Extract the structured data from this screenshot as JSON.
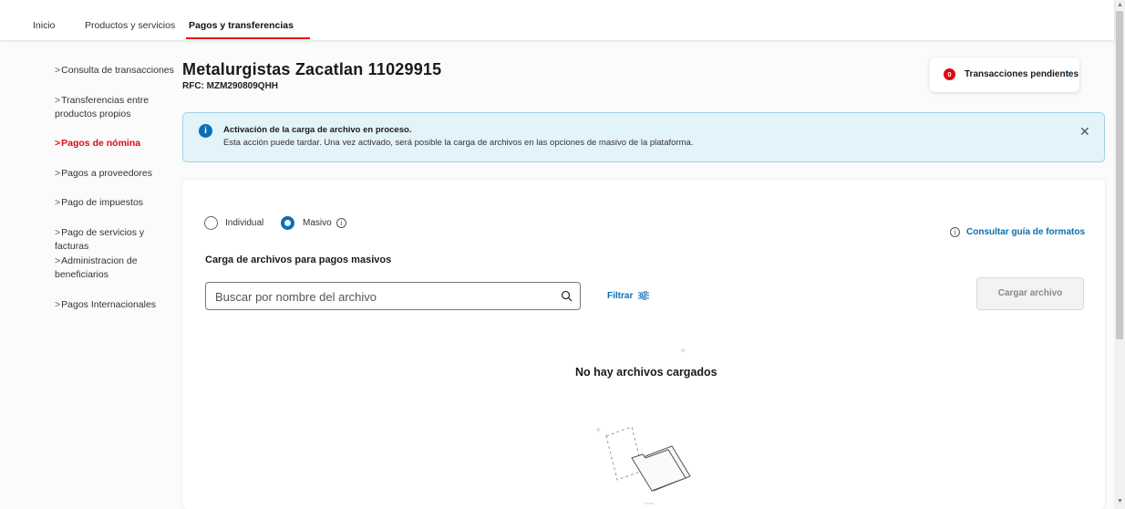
{
  "topnav": {
    "tabs": [
      {
        "label": "Inicio"
      },
      {
        "label": "Productos y servicios"
      },
      {
        "label": "Pagos y transferencias",
        "active": true
      }
    ]
  },
  "sidebar": {
    "items": [
      {
        "label": "Consulta de transacciones"
      },
      {
        "label": "Transferencias entre productos propios"
      },
      {
        "label": "Pagos de nómina",
        "active": true
      },
      {
        "label": "Pagos a proveedores"
      },
      {
        "label": "Pago de impuestos"
      },
      {
        "label": "Pago de servicios y facturas"
      },
      {
        "label": "Administracion de beneficiarios"
      },
      {
        "label": "Pagos Internacionales"
      }
    ]
  },
  "header": {
    "company": "Metalurgistas Zacatlan 11029915",
    "rfc": "RFC: MZM290809QHH",
    "pending": {
      "count": "0",
      "label": "Transacciones pendientes"
    }
  },
  "alert": {
    "title": "Activación de la carga de archivo en proceso.",
    "text": "Esta acción puede tardar. Una vez activado, será posible la carga de archivos en las opciones de masivo de la plataforma."
  },
  "main": {
    "mode_options": [
      {
        "label": "Individual",
        "selected": false
      },
      {
        "label": "Masivo",
        "selected": true
      }
    ],
    "guide_link": "Consultar guía de formatos",
    "section_title": "Carga de archivos para pagos masivos",
    "search_placeholder": "Buscar por nombre del archivo",
    "filter_label": "Filtrar",
    "upload_button": "Cargar archivo",
    "empty_message": "No hay archivos cargados"
  },
  "colors": {
    "brand_red": "#e30613",
    "accent_blue": "#0a6fb3",
    "alert_bg": "#e3f3fa"
  }
}
